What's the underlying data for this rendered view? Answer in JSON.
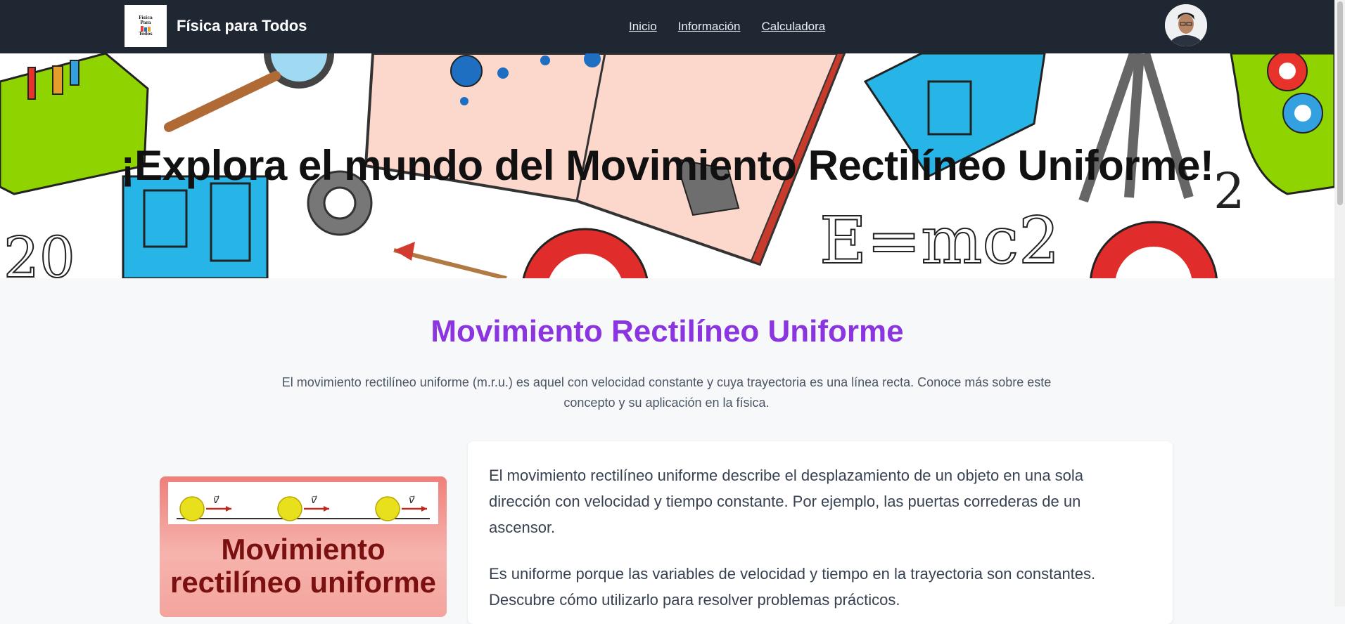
{
  "navbar": {
    "logo_lines": [
      "Física",
      "Para",
      "Todos"
    ],
    "brand": "Física para Todos",
    "links": [
      "Inicio",
      "Información",
      "Calculadora"
    ],
    "avatar_icon": "user-avatar"
  },
  "hero": {
    "title": "¡Explora el mundo del Movimiento Rectilíneo Uniforme!",
    "background_image": "physics-doodles-background",
    "doodle_text": [
      "E=mc2",
      "20",
      "2"
    ]
  },
  "main": {
    "title": "Movimiento Rectilíneo Uniforme",
    "description": "El movimiento rectilíneo uniforme (m.r.u.) es aquel con velocidad constante y cuya trayectoria es una línea recta. Conoce más sobre este concepto y su aplicación en la física.",
    "image": {
      "text_line1": "Movimiento",
      "text_line2": "rectilíneo uniforme",
      "vector_label": "v⃗"
    },
    "paragraphs": [
      "El movimiento rectilíneo uniforme describe el desplazamiento de un objeto en una sola dirección con velocidad y tiempo constante. Por ejemplo, las puertas correderas de un ascensor.",
      "Es uniforme porque las variables de velocidad y tiempo en la trayectoria son constantes. Descubre cómo utilizarlo para resolver problemas prácticos."
    ]
  },
  "colors": {
    "navbar_bg": "#1f2733",
    "accent_purple": "#8b35e0",
    "page_bg": "#f7f8fa"
  }
}
